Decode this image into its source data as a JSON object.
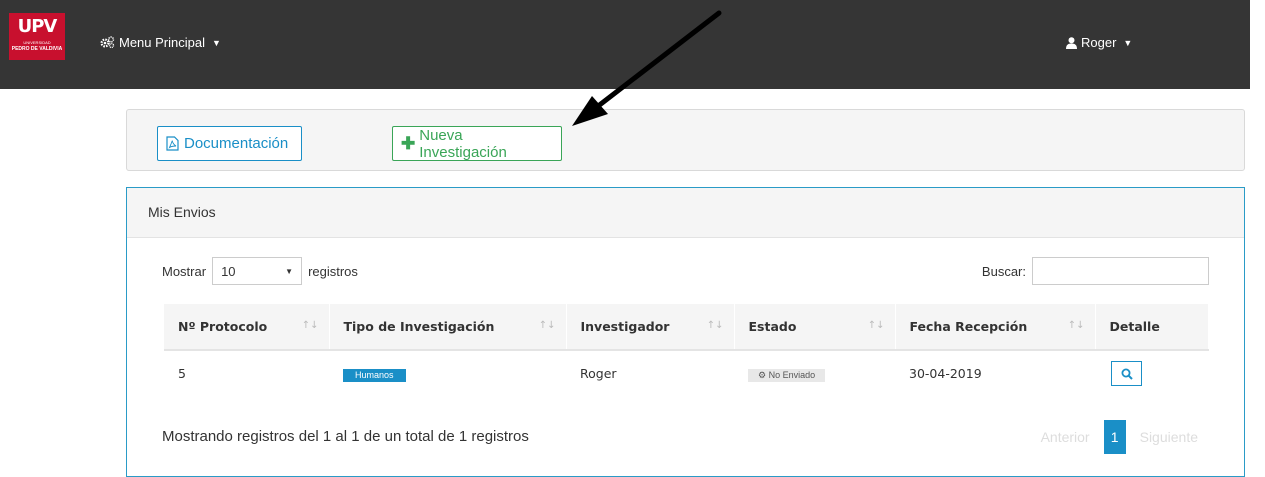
{
  "navbar": {
    "logo_text": "UPV",
    "logo_sub1": "UNIVERSIDAD",
    "logo_sub2": "PEDRO DE VALDIVIA",
    "menu_label": "Menu Principal",
    "menu_icon": "gears-icon",
    "user_label": "Roger",
    "user_icon": "user-icon"
  },
  "toolbar": {
    "doc_label": "Documentación",
    "doc_icon": "pdf-file-icon",
    "new_label": "Nueva Investigación",
    "new_icon": "plus-icon"
  },
  "panel": {
    "title": "Mis Envios",
    "show_label": "Mostrar",
    "show_value": "10",
    "records_label": "registros",
    "search_label": "Buscar:",
    "search_value": ""
  },
  "table": {
    "columns": [
      "Nº Protocolo",
      "Tipo de Investigación",
      "Investigador",
      "Estado",
      "Fecha Recepción",
      "Detalle"
    ],
    "rows": [
      {
        "protocolo": "5",
        "tipo": "Humanos",
        "investigador": "Roger",
        "estado": "No Enviado",
        "fecha": "30-04-2019"
      }
    ]
  },
  "footer": {
    "info": "Mostrando registros del 1 al 1 de un total de 1 registros",
    "prev": "Anterior",
    "page": "1",
    "next": "Siguiente"
  },
  "colors": {
    "navbar": "#353535",
    "brand_red": "#c8102e",
    "primary": "#1a8fc7",
    "success": "#3aa557"
  }
}
